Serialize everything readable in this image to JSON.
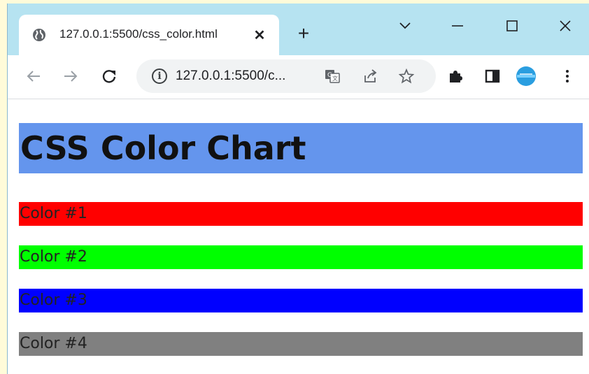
{
  "browser": {
    "tab": {
      "title": "127.0.0.1:5500/css_color.html",
      "favicon": "globe-icon",
      "close_symbol": "✕"
    },
    "new_tab_symbol": "+",
    "window_controls": [
      "chevron-down-icon",
      "minimize-icon",
      "maximize-icon",
      "close-icon"
    ],
    "toolbar": {
      "back": "back-arrow-icon",
      "forward": "forward-arrow-icon",
      "reload": "reload-icon",
      "url": "127.0.0.1:5500/c...",
      "info_symbol": "i",
      "omnibox_icons": [
        "translate-icon",
        "share-icon",
        "star-icon"
      ],
      "right_icons": [
        "extensions-icon",
        "side-panel-icon",
        "profile-avatar",
        "menu-icon"
      ]
    }
  },
  "page": {
    "heading": "CSS Color Chart",
    "heading_bg": "#6495ed",
    "rows": [
      {
        "label": "Color #1",
        "bg": "#ff0000"
      },
      {
        "label": "Color #2",
        "bg": "#00ff00"
      },
      {
        "label": "Color #3",
        "bg": "#0000ff"
      },
      {
        "label": "Color #4",
        "bg": "#808080"
      }
    ]
  }
}
